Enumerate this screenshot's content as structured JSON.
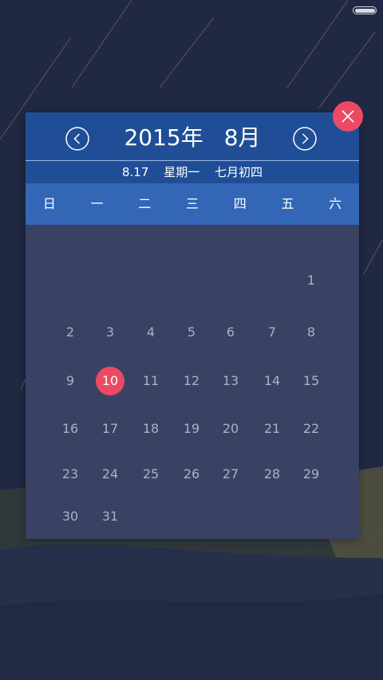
{
  "calendar": {
    "year_month_title": [
      "2015年",
      "8月"
    ],
    "date_info": [
      "8.17",
      "星期一",
      "七月初四"
    ],
    "weekdays": [
      "日",
      "一",
      "二",
      "三",
      "四",
      "五",
      "六"
    ],
    "first_weekday_index": 6,
    "days": [
      "1",
      "2",
      "3",
      "4",
      "5",
      "6",
      "7",
      "8",
      "9",
      "10",
      "11",
      "12",
      "13",
      "14",
      "15",
      "16",
      "17",
      "18",
      "19",
      "20",
      "21",
      "22",
      "23",
      "24",
      "25",
      "26",
      "27",
      "28",
      "29",
      "30",
      "31"
    ],
    "selected_day": "10"
  },
  "colors": {
    "header_bg": "#204e96",
    "weekday_bg": "#3367b6",
    "grid_bg": "#394263",
    "accent": "#ec4a64"
  },
  "icons": {
    "prev": "chevron-left-circle-icon",
    "next": "chevron-right-circle-icon",
    "close": "close-icon",
    "battery": "battery-icon"
  },
  "status_bar": {
    "battery_level": 1.0
  }
}
